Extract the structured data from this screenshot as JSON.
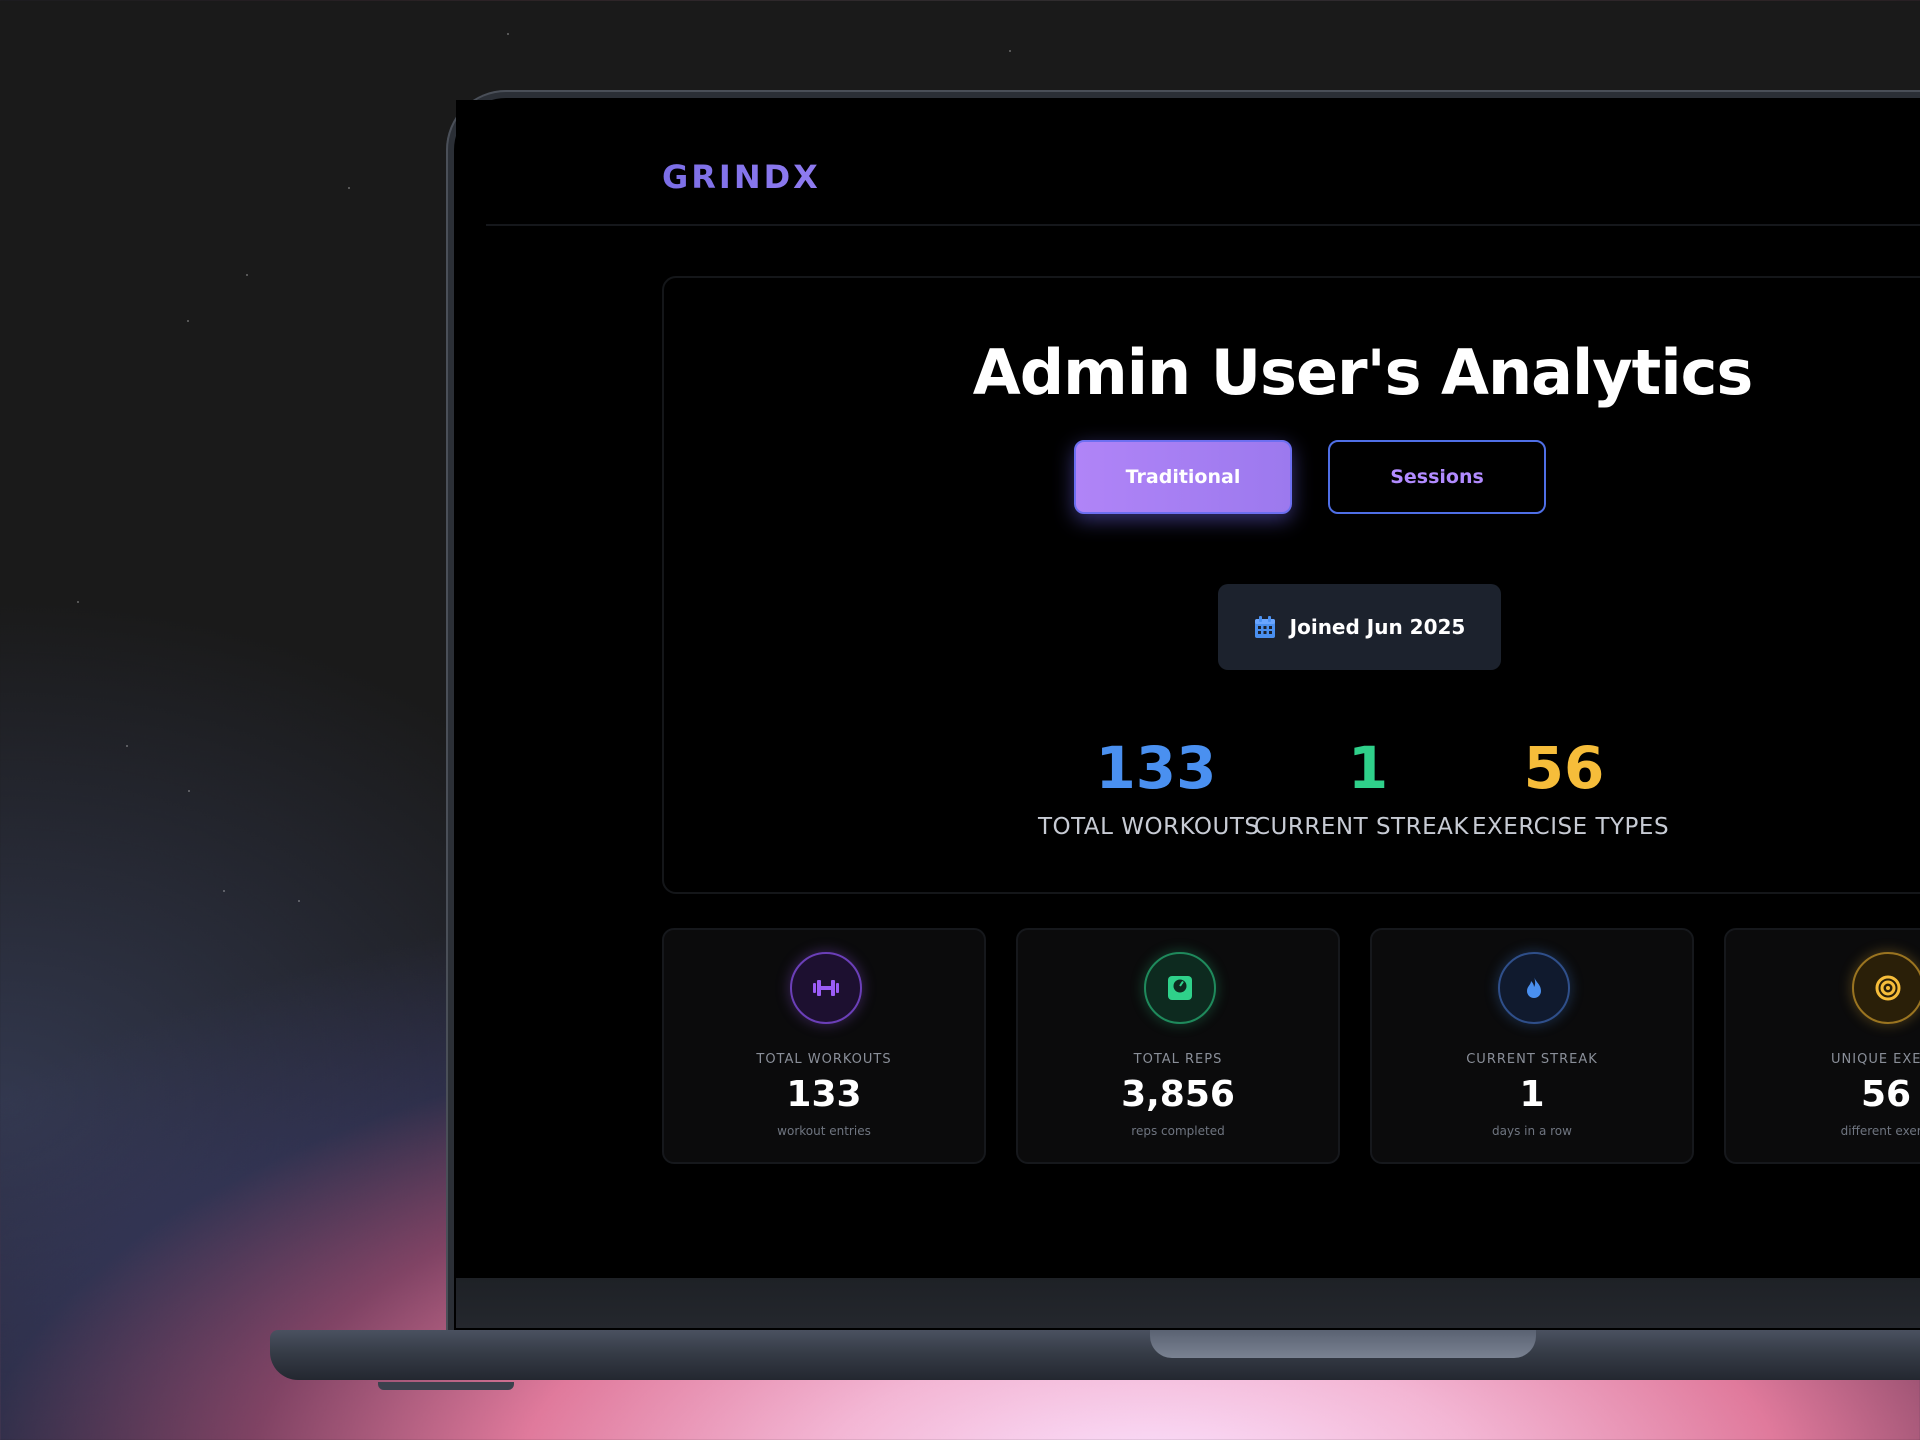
{
  "app": {
    "logo": "GRINDX"
  },
  "hero": {
    "title": "Admin User's Analytics",
    "tabs": [
      {
        "label": "Traditional",
        "active": true
      },
      {
        "label": "Sessions",
        "active": false
      }
    ],
    "joined": "Joined Jun 2025",
    "stats": [
      {
        "value": "133",
        "label": "TOTAL WORKOUTS",
        "color": "#4a90f0"
      },
      {
        "value": "1",
        "label": "CURRENT STREAK",
        "color": "#2fd08a"
      },
      {
        "value": "56",
        "label": "EXERCISE TYPES",
        "color": "#f6bd3a"
      }
    ]
  },
  "cards": [
    {
      "icon": "dumbbell-icon",
      "label": "TOTAL WORKOUTS",
      "value": "133",
      "sub": "workout entries",
      "color": "#9b5cf6"
    },
    {
      "icon": "scale-icon",
      "label": "TOTAL REPS",
      "value": "3,856",
      "sub": "reps completed",
      "color": "#2fd08a"
    },
    {
      "icon": "flame-icon",
      "label": "CURRENT STREAK",
      "value": "1",
      "sub": "days in a row",
      "color": "#4a90f0"
    },
    {
      "icon": "target-icon",
      "label": "UNIQUE EXERC",
      "value": "56",
      "sub": "different exerci",
      "color": "#f6bd3a"
    }
  ]
}
